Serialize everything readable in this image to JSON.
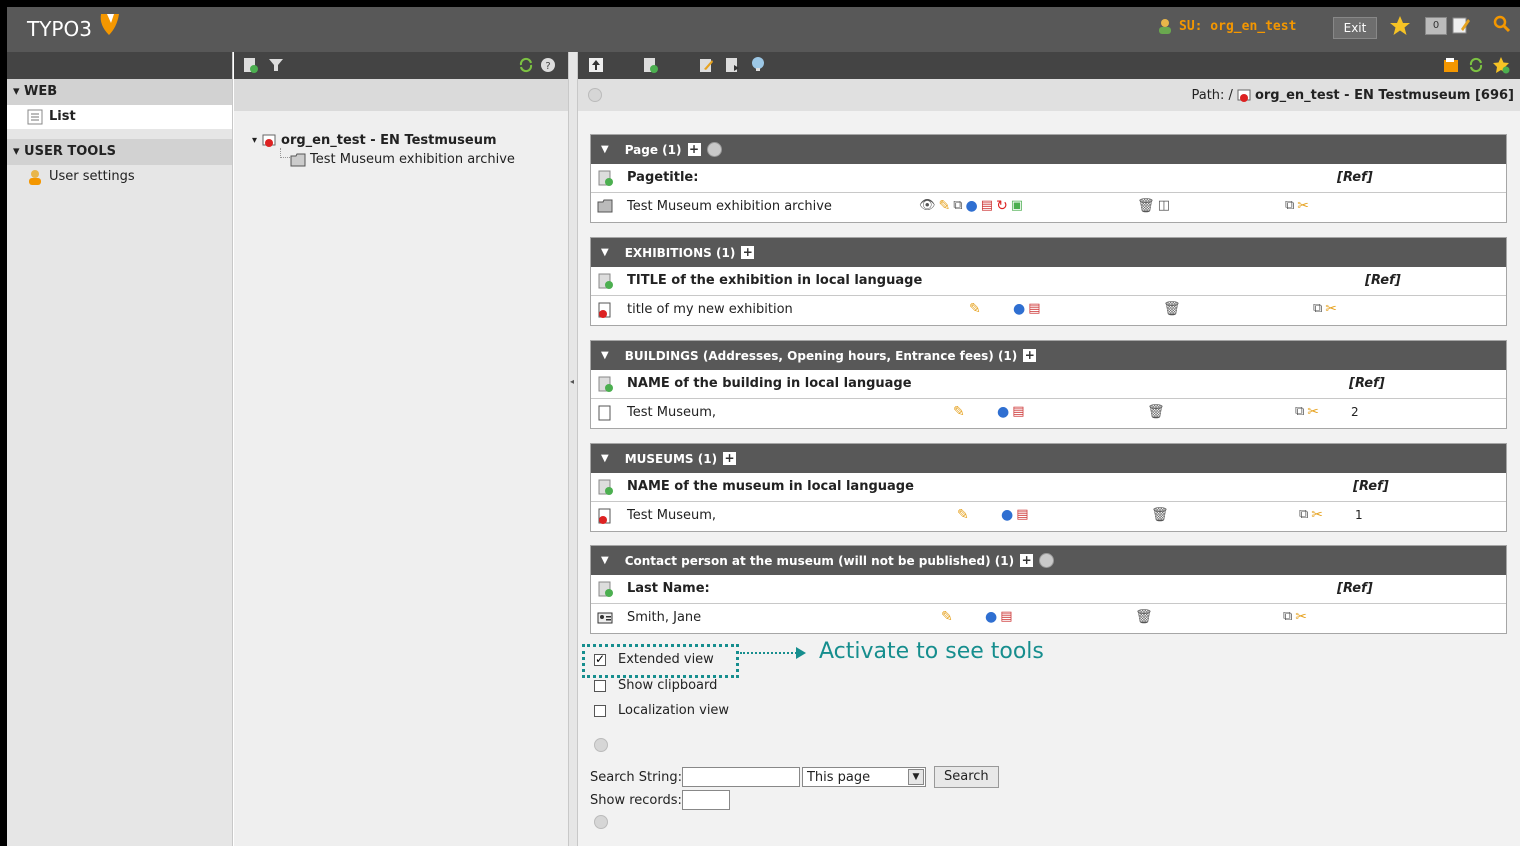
{
  "app": {
    "logo": "TYPO3"
  },
  "topbar": {
    "user": "SU: org_en_test",
    "exit_label": "Exit",
    "badge_count": "0"
  },
  "modules": {
    "groups": [
      {
        "label": "▾ WEB",
        "items": [
          {
            "label": "List",
            "active": true
          }
        ]
      },
      {
        "label": "▾ USER TOOLS",
        "items": [
          {
            "label": "User settings",
            "active": false
          }
        ]
      }
    ]
  },
  "tree": {
    "root": "org_en_test - EN Testmuseum",
    "child": "Test Museum exhibition archive"
  },
  "path": {
    "label": "Path: /",
    "page": "org_en_test - EN Testmuseum [696]"
  },
  "tables": [
    {
      "title": "Page (1)",
      "column": "Pagetitle:",
      "ref": "[Ref]",
      "record": "Test Museum exhibition archive",
      "count": ""
    },
    {
      "title": "EXHIBITIONS (1)",
      "column": "TITLE of the exhibition in local language",
      "ref": "[Ref]",
      "record": "title of my new exhibition",
      "count": ""
    },
    {
      "title": "BUILDINGS (Addresses, Opening hours, Entrance fees) (1)",
      "column": "NAME of the building in local language",
      "ref": "[Ref]",
      "record": "Test Museum,",
      "count": "2"
    },
    {
      "title": "MUSEUMS (1)",
      "column": "NAME of the museum in local language",
      "ref": "[Ref]",
      "record": "Test Museum,",
      "count": "1"
    },
    {
      "title": "Contact person at the museum (will not be published) (1)",
      "column": "Last Name:",
      "ref": "[Ref]",
      "record": "Smith, Jane",
      "count": ""
    }
  ],
  "options": {
    "extended_view": "Extended view",
    "show_clipboard": "Show clipboard",
    "localization_view": "Localization view"
  },
  "callout": "Activate to see tools",
  "search": {
    "label": "Search String:",
    "value": "",
    "scope": "This page",
    "button": "Search",
    "show_records_label": "Show records:"
  },
  "colors": {
    "topbar": "#585858",
    "accent_orange": "#f49700",
    "callout": "#168e8e"
  }
}
